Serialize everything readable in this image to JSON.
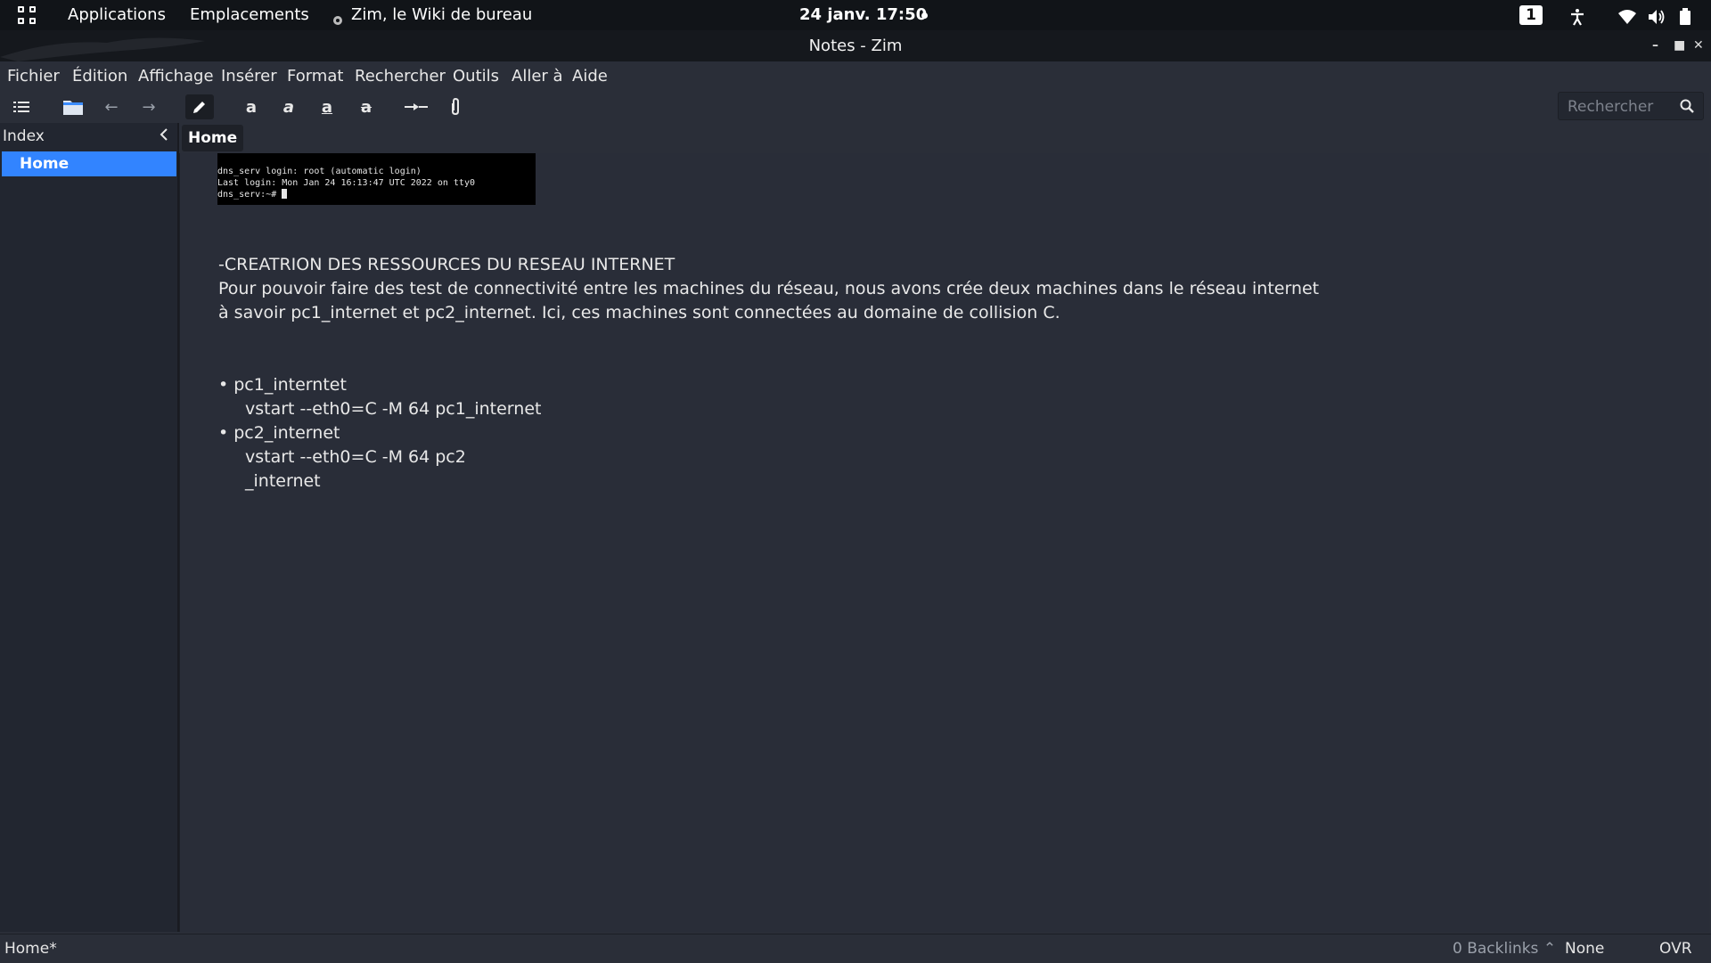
{
  "topbar": {
    "applications": "Applications",
    "places": "Emplacements",
    "active_app": "Zim, le Wiki de bureau",
    "clock": "24 janv.  17:50",
    "workspace": "1",
    "icons": [
      "apps-grid-icon",
      "zim-icon",
      "accessibility-icon",
      "wifi-icon",
      "volume-icon",
      "battery-icon"
    ]
  },
  "window": {
    "title": "Notes - Zim"
  },
  "menu": [
    "Fichier",
    "Édition",
    "Affichage",
    "Insérer",
    "Format",
    "Rechercher",
    "Outils",
    "Aller à",
    "Aide"
  ],
  "toolbar": {
    "icons": [
      "index-list-icon",
      "folder-icon",
      "back-arrow-icon",
      "forward-arrow-icon",
      "edit-pencil-icon",
      "bold-icon",
      "italic-icon",
      "underline-icon",
      "strikethrough-icon",
      "link-icon",
      "attach-icon"
    ],
    "search_placeholder": "Rechercher"
  },
  "sidepane": {
    "header": "Index",
    "items": [
      "Home"
    ]
  },
  "pathbar": {
    "current": "Home"
  },
  "page": {
    "terminal_lines": [
      "dns_serv login: root (automatic login)",
      "Last login: Mon Jan 24 16:13:47 UTC 2022 on tty0",
      "dns_serv:~# "
    ],
    "heading": "-CREATRION DES RESSOURCES DU RESEAU INTERNET",
    "para_line1": "Pour pouvoir faire des test de connectivité entre les machines du réseau, nous avons crée deux machines dans le  réseau internet",
    "para_line2": "à savoir pc1_internet et pc2_internet. Ici, ces machines  sont connectées au domaine de collision C.",
    "bullets": [
      {
        "title": "pc1_interntet",
        "lines": [
          "vstart --eth0=C -M 64  pc1_internet"
        ]
      },
      {
        "title": "pc2_internet",
        "lines": [
          "vstart --eth0=C -M 64  pc2",
          "_internet"
        ]
      }
    ]
  },
  "statusbar": {
    "page": "Home*",
    "backlinks": "0 Backlinks",
    "style": "None",
    "mode": "OVR"
  },
  "colors": {
    "selection": "#3284ff",
    "background": "#2a2e38",
    "topbar": "#111418"
  }
}
